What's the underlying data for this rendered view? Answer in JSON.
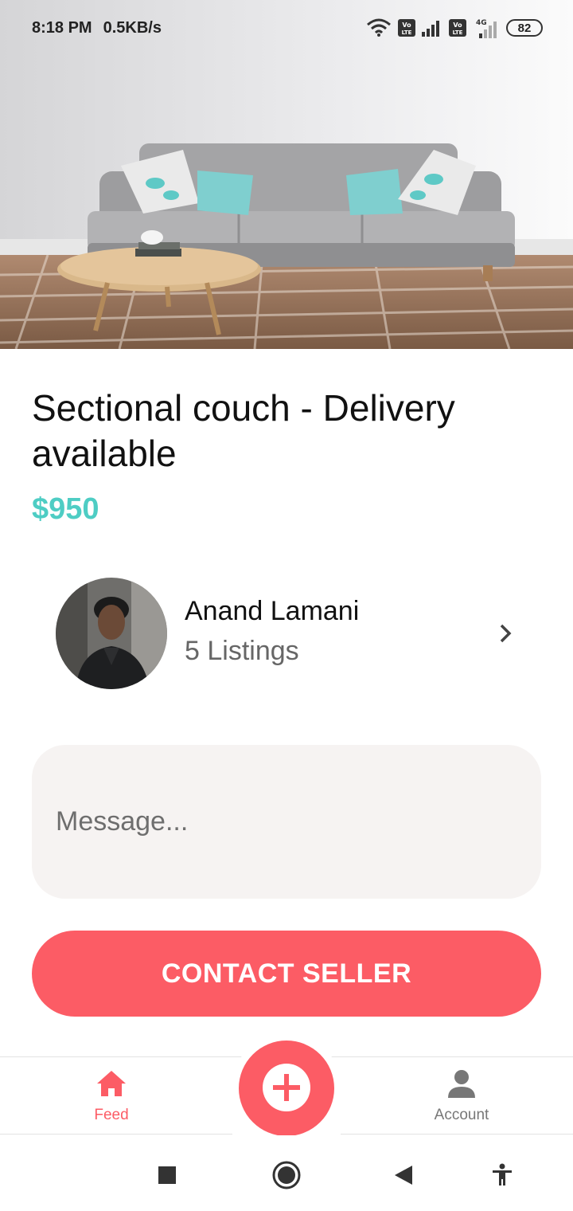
{
  "status_bar": {
    "time": "8:18 PM",
    "speed": "0.5KB/s",
    "volte1": "Vo\nLTE",
    "volte2": "Vo\nLTE",
    "net": "4G",
    "battery": "82"
  },
  "listing": {
    "title": "Sectional couch - Delivery available",
    "price": "$950",
    "image_icon": "sofa-photo"
  },
  "seller": {
    "name": "Anand Lamani",
    "listings": "5 Listings",
    "avatar_icon": "avatar-photo"
  },
  "message": {
    "placeholder": "Message...",
    "value": ""
  },
  "contact_button": "CONTACT SELLER",
  "tabs": [
    {
      "label": "Feed",
      "icon": "home-icon",
      "active": true
    },
    {
      "label": "Account",
      "icon": "person-icon",
      "active": false
    }
  ],
  "fab_icon": "plus-icon",
  "colors": {
    "accent": "#fc5c65",
    "price": "#4ecdc4",
    "message_bg": "#f6f3f2"
  }
}
